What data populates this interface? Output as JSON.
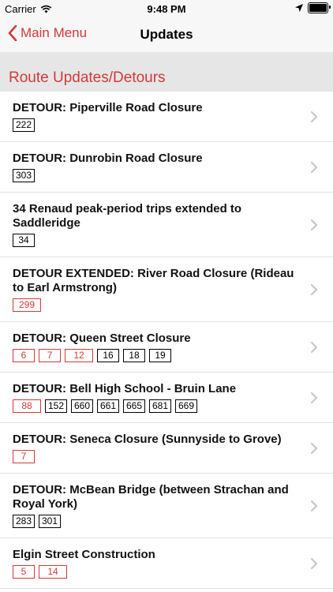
{
  "status": {
    "carrier": "Carrier",
    "time": "9:48 PM"
  },
  "nav": {
    "back_label": "Main Menu",
    "title": "Updates"
  },
  "section": {
    "title": "Route Updates/Detours"
  },
  "colors": {
    "accent": "#d23a3a"
  },
  "updates": [
    {
      "title": "DETOUR: Piperville Road Closure",
      "routes": [
        {
          "num": "222",
          "color": "black"
        }
      ]
    },
    {
      "title": "DETOUR: Dunrobin Road Closure",
      "routes": [
        {
          "num": "303",
          "color": "black"
        }
      ]
    },
    {
      "title": "34 Renaud peak-period trips extended to Saddleridge",
      "routes": [
        {
          "num": "34",
          "color": "black"
        }
      ]
    },
    {
      "title": "DETOUR EXTENDED: River Road Closure (Rideau to Earl Armstrong)",
      "routes": [
        {
          "num": "299",
          "color": "red"
        }
      ]
    },
    {
      "title": "DETOUR: Queen Street Closure",
      "routes": [
        {
          "num": "6",
          "color": "red"
        },
        {
          "num": "7",
          "color": "red"
        },
        {
          "num": "12",
          "color": "red"
        },
        {
          "num": "16",
          "color": "black"
        },
        {
          "num": "18",
          "color": "black"
        },
        {
          "num": "19",
          "color": "black"
        }
      ]
    },
    {
      "title": "DETOUR: Bell High School - Bruin Lane",
      "routes": [
        {
          "num": "88",
          "color": "red"
        },
        {
          "num": "152",
          "color": "black"
        },
        {
          "num": "660",
          "color": "black"
        },
        {
          "num": "661",
          "color": "black"
        },
        {
          "num": "665",
          "color": "black"
        },
        {
          "num": "681",
          "color": "black"
        },
        {
          "num": "669",
          "color": "black"
        }
      ]
    },
    {
      "title": "DETOUR: Seneca Closure (Sunnyside to Grove)",
      "routes": [
        {
          "num": "7",
          "color": "red"
        }
      ]
    },
    {
      "title": "DETOUR: McBean Bridge (between Strachan and Royal York)",
      "routes": [
        {
          "num": "283",
          "color": "black"
        },
        {
          "num": "301",
          "color": "black"
        }
      ]
    },
    {
      "title": "Elgin Street Construction",
      "routes": [
        {
          "num": "5",
          "color": "red"
        },
        {
          "num": "14",
          "color": "red"
        }
      ]
    }
  ]
}
